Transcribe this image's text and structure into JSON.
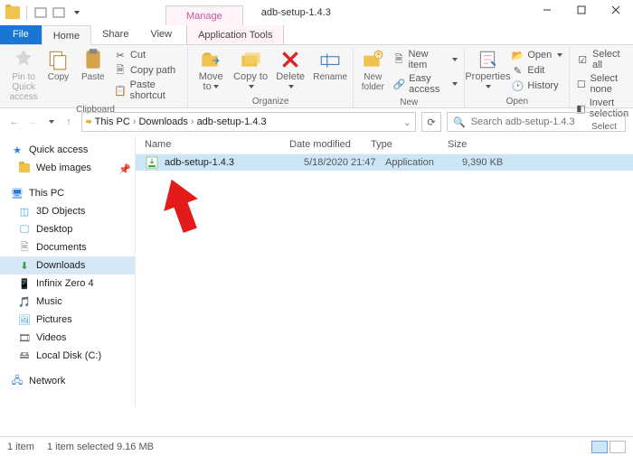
{
  "window": {
    "manage_label": "Manage",
    "title": "adb-setup-1.4.3",
    "min": "—",
    "max": "▢",
    "close": "✕"
  },
  "tabs": {
    "file": "File",
    "home": "Home",
    "share": "Share",
    "view": "View",
    "apptools": "Application Tools"
  },
  "ribbon": {
    "clipboard": {
      "pin": "Pin to Quick access",
      "copy": "Copy",
      "paste": "Paste",
      "cut": "Cut",
      "copypath": "Copy path",
      "pasteshortcut": "Paste shortcut",
      "label": "Clipboard"
    },
    "organize": {
      "moveto": "Move to",
      "copyto": "Copy to",
      "delete": "Delete",
      "rename": "Rename",
      "label": "Organize"
    },
    "new": {
      "newfolder": "New folder",
      "newitem": "New item",
      "easyaccess": "Easy access",
      "label": "New"
    },
    "open": {
      "properties": "Properties",
      "open": "Open",
      "edit": "Edit",
      "history": "History",
      "label": "Open"
    },
    "select": {
      "selectall": "Select all",
      "selectnone": "Select none",
      "invert": "Invert selection",
      "label": "Select"
    }
  },
  "breadcrumb": {
    "root": "This PC",
    "mid": "Downloads",
    "leaf": "adb-setup-1.4.3"
  },
  "search": {
    "placeholder": "Search adb-setup-1.4.3"
  },
  "sidebar": {
    "quick": "Quick access",
    "web": "Web images",
    "thispc": "This PC",
    "items": [
      "3D Objects",
      "Desktop",
      "Documents",
      "Downloads",
      "Infinix Zero 4",
      "Music",
      "Pictures",
      "Videos",
      "Local Disk (C:)"
    ],
    "network": "Network"
  },
  "columns": {
    "name": "Name",
    "date": "Date modified",
    "type": "Type",
    "size": "Size"
  },
  "files": [
    {
      "name": "adb-setup-1.4.3",
      "date": "5/18/2020 21:47",
      "type": "Application",
      "size": "9,390 KB"
    }
  ],
  "status": {
    "count": "1 item",
    "sel": "1 item selected  9.16 MB"
  }
}
